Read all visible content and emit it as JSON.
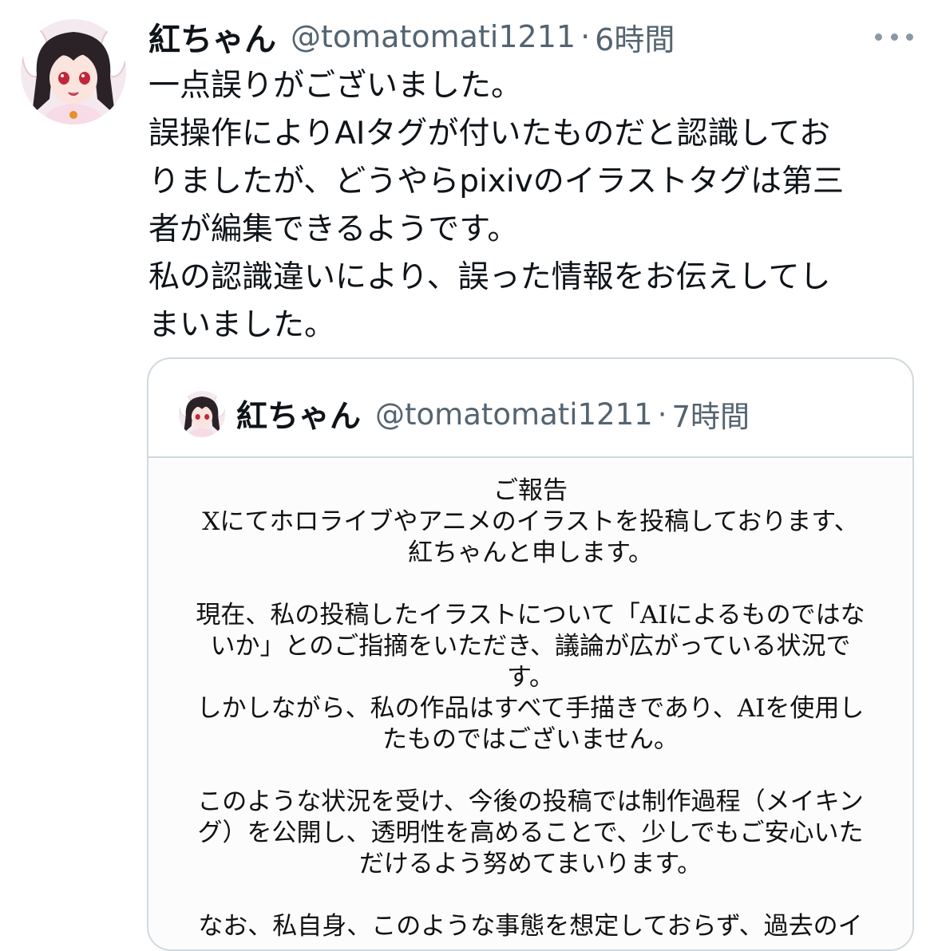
{
  "tweet": {
    "display_name": "紅ちゃん",
    "handle": "@tomatomati1211",
    "separator": "·",
    "time": "6時間",
    "more_icon": "more-horizontal-icon",
    "lines": [
      "一点誤りがございました。",
      "誤操作によりAIタグが付いたものだと認識してお",
      "りましたが、どうやらpixivのイラストタグは第三",
      "者が編集できるようです。",
      "私の認識違いにより、誤った情報をお伝えしてし",
      "まいました。"
    ]
  },
  "quote": {
    "display_name": "紅ちゃん",
    "handle": "@tomatomati1211",
    "separator": "·",
    "time": "7時間",
    "image_lines": [
      "ご報告",
      "Xにてホロライブやアニメのイラストを投稿しております、",
      "紅ちゃんと申します。",
      "",
      "現在、私の投稿したイラストについて「AIによるものではな",
      "いか」とのご指摘をいただき、議論が広がっている状況で",
      "す。",
      "しかしながら、私の作品はすべて手描きであり、AIを使用し",
      "たものではございません。",
      "",
      "このような状況を受け、今後の投稿では制作過程（メイキン",
      "グ）を公開し、透明性を高めることで、少しでもご安心いた",
      "だけるよう努めてまいります。",
      "",
      "なお、私自身、このような事態を想定しておらず、過去のイ"
    ]
  },
  "colors": {
    "text": "#0f1419",
    "secondary": "#536471",
    "border": "#cfd9de"
  }
}
